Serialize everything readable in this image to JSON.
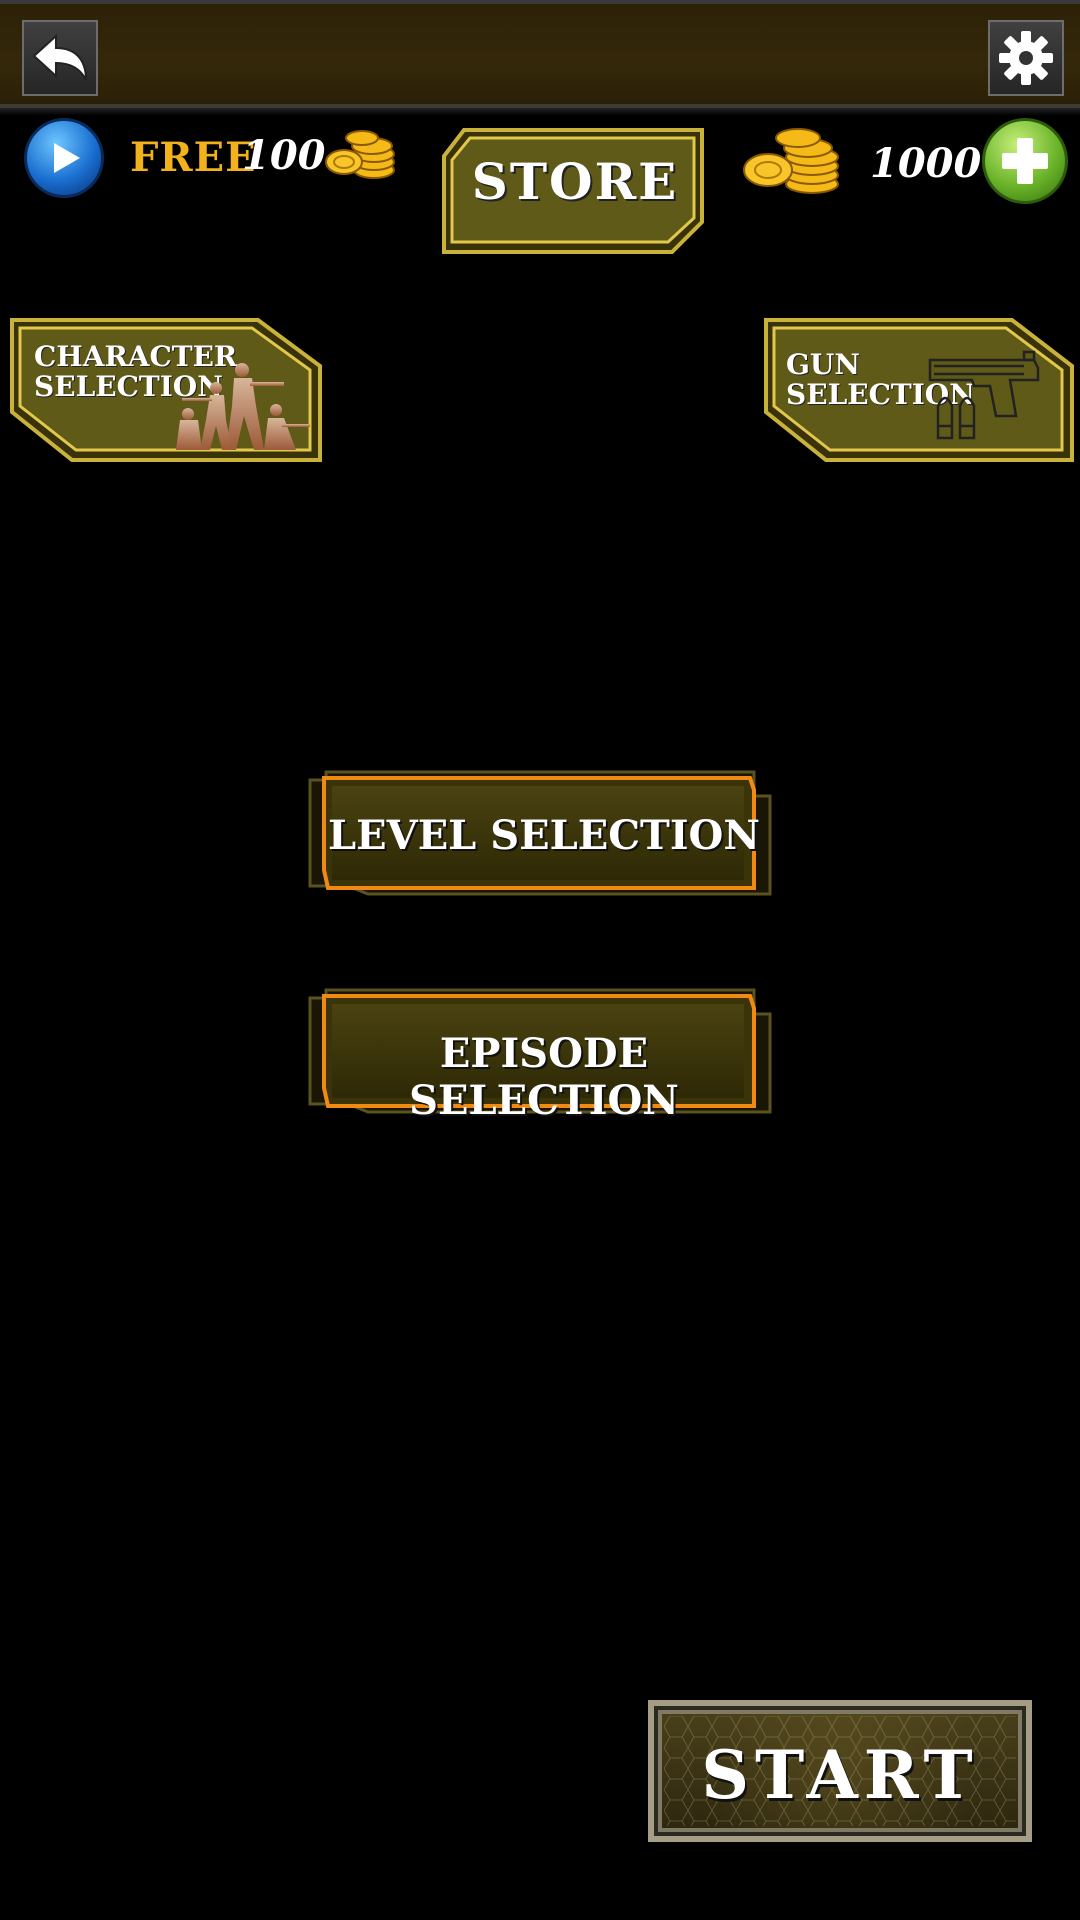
{
  "topbar": {
    "back_icon": "back-arrow-icon",
    "settings_icon": "gear-icon"
  },
  "currency": {
    "free_label": "FREE",
    "free_amount": "100",
    "coin_total": "1000",
    "play_icon": "play-icon",
    "plus_icon": "plus-icon",
    "coin_icon": "coin-stack-icon"
  },
  "store": {
    "label": "STORE"
  },
  "character_selection": {
    "line1": "CHARACTER",
    "line2": "SELECTION",
    "art_icon": "soldiers-silhouette-icon"
  },
  "gun_selection": {
    "line1": "GUN",
    "line2": "SELECTION",
    "art_icon": "pistol-bullets-icon"
  },
  "menu": {
    "level_label": "LEVEL SELECTION",
    "episode_label": "EPISODE SELECTION"
  },
  "start": {
    "label": "START"
  },
  "colors": {
    "background": "#000000",
    "topbar": "#35280a",
    "olive_panel": "#5f5a17",
    "gold_border": "#c9b23a",
    "orange_border": "#e6870f",
    "free_text": "#f2b21c"
  }
}
